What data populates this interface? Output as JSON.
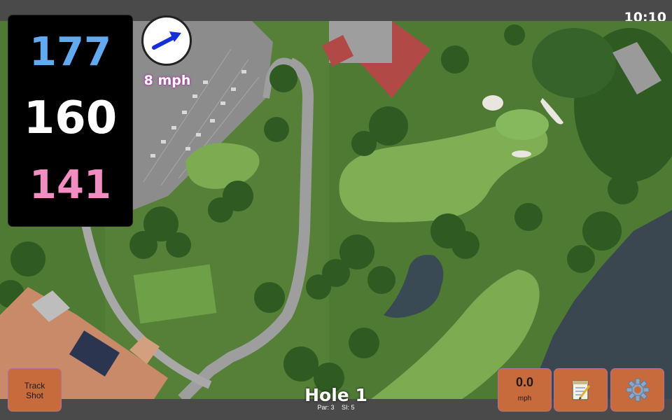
{
  "status": {
    "time": "10:10"
  },
  "yardages": {
    "back": "177",
    "middle": "160",
    "front": "141"
  },
  "wind": {
    "speed_label": "8 mph",
    "direction_icon": "arrow-icon"
  },
  "buttons": {
    "track_shot_line1": "Track",
    "track_shot_line2": "Shot",
    "speed_value": "0.0",
    "speed_unit": "mph",
    "notes_icon": "notepad-icon",
    "settings_icon": "gear-icon"
  },
  "hole": {
    "title": "Hole 1",
    "par": "Par: 3",
    "si": "SI: 5"
  },
  "colors": {
    "accent_button": "#c86b3c",
    "back_yardage": "#63a9f0",
    "mid_yardage": "#ffffff",
    "front_yardage": "#f08dc2",
    "wind_label_glow": "#c040c0"
  }
}
